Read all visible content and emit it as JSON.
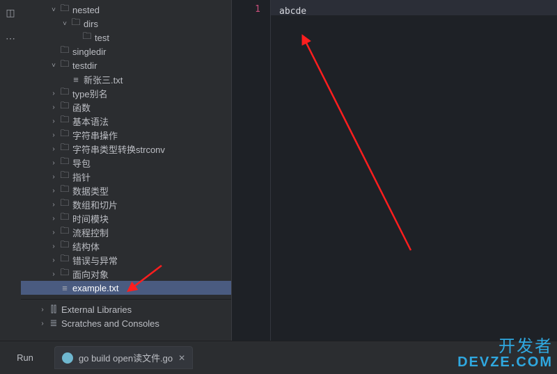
{
  "editor": {
    "line_number": "1",
    "content": "abcde"
  },
  "tree": [
    {
      "depth": 2,
      "arrow": "down",
      "icon": "folder",
      "label": "nested"
    },
    {
      "depth": 3,
      "arrow": "down",
      "icon": "folder",
      "label": "dirs"
    },
    {
      "depth": 4,
      "arrow": "",
      "icon": "folder",
      "label": "test"
    },
    {
      "depth": 2,
      "arrow": "",
      "icon": "folder",
      "label": "singledir"
    },
    {
      "depth": 2,
      "arrow": "down",
      "icon": "folder",
      "label": "testdir"
    },
    {
      "depth": 3,
      "arrow": "",
      "icon": "file",
      "label": "新张三.txt"
    },
    {
      "depth": 2,
      "arrow": "right",
      "icon": "folder",
      "label": "type别名"
    },
    {
      "depth": 2,
      "arrow": "right",
      "icon": "folder",
      "label": "函数"
    },
    {
      "depth": 2,
      "arrow": "right",
      "icon": "folder",
      "label": "基本语法"
    },
    {
      "depth": 2,
      "arrow": "right",
      "icon": "folder",
      "label": "字符串操作"
    },
    {
      "depth": 2,
      "arrow": "right",
      "icon": "folder",
      "label": "字符串类型转换strconv"
    },
    {
      "depth": 2,
      "arrow": "right",
      "icon": "folder",
      "label": "导包"
    },
    {
      "depth": 2,
      "arrow": "right",
      "icon": "folder",
      "label": "指针"
    },
    {
      "depth": 2,
      "arrow": "right",
      "icon": "folder",
      "label": "数据类型"
    },
    {
      "depth": 2,
      "arrow": "right",
      "icon": "folder",
      "label": "数组和切片"
    },
    {
      "depth": 2,
      "arrow": "right",
      "icon": "folder",
      "label": "时间模块"
    },
    {
      "depth": 2,
      "arrow": "right",
      "icon": "folder",
      "label": "流程控制"
    },
    {
      "depth": 2,
      "arrow": "right",
      "icon": "folder",
      "label": "结构体"
    },
    {
      "depth": 2,
      "arrow": "right",
      "icon": "folder",
      "label": "错误与异常"
    },
    {
      "depth": 2,
      "arrow": "right",
      "icon": "folder",
      "label": "面向对象"
    },
    {
      "depth": 2,
      "arrow": "",
      "icon": "file",
      "label": "example.txt",
      "selected": true
    },
    {
      "depth": 1,
      "arrow": "right",
      "icon": "lib",
      "label": "External Libraries"
    },
    {
      "depth": 1,
      "arrow": "right",
      "icon": "scratch",
      "label": "Scratches and Consoles"
    }
  ],
  "bottom": {
    "run_label": "Run",
    "tab_label": "go build open读文件.go"
  },
  "watermark": {
    "line1": "开发者",
    "line2": "DevZe.CoM"
  }
}
